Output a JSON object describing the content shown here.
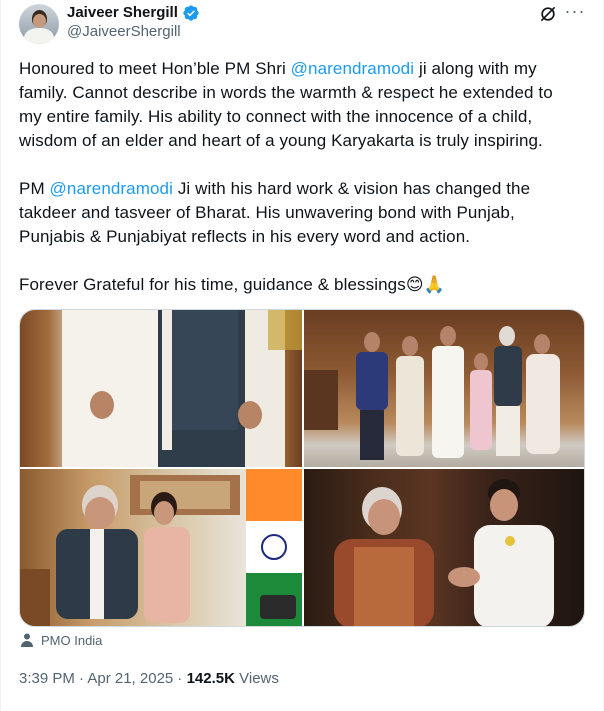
{
  "author": {
    "display_name": "Jaiveer Shergill",
    "handle": "@JaiveerShergill",
    "verified_color": "#1d9bf0",
    "avatar_icon": "profile-photo"
  },
  "header_icons": {
    "grok": "grok-icon",
    "more": "···"
  },
  "tweet": {
    "p1": {
      "l1_a": "Honoured to meet Hon’ble PM Shri ",
      "l1_mention": "@narendramodi",
      "l1_b": " ji along with my",
      "l2": "family. Cannot describe in words the warmth & respect he extended to",
      "l3": "my entire family. His ability to connect with the innocence of a child,",
      "l4": "wisdom of an elder and heart of a young Karyakarta is truly inspiring."
    },
    "p2": {
      "l1_a": "PM ",
      "l1_mention": "@narendramodi",
      "l1_b": " Ji with his hard work & vision has changed the",
      "l2": "takdeer and tasveer of Bharat. His unwavering bond with Punjab,",
      "l3": "Punjabis & Punjabiyat reflects in his every word and action."
    },
    "p3": {
      "text": "Forever Grateful for his time, guidance & blessings",
      "emoji1": "😊",
      "emoji2": "🙏"
    },
    "mention_color": "#1d9bf0"
  },
  "media": {
    "photos": [
      "photo-two-men-standing",
      "photo-family-group",
      "photo-child-with-pm",
      "photo-handshake"
    ]
  },
  "location": {
    "icon": "person-icon",
    "label": "PMO India"
  },
  "meta": {
    "time_date": "3:39 PM · Apr 21, 2025 · ",
    "views_count": "142.5K",
    "views_label": " Views"
  }
}
